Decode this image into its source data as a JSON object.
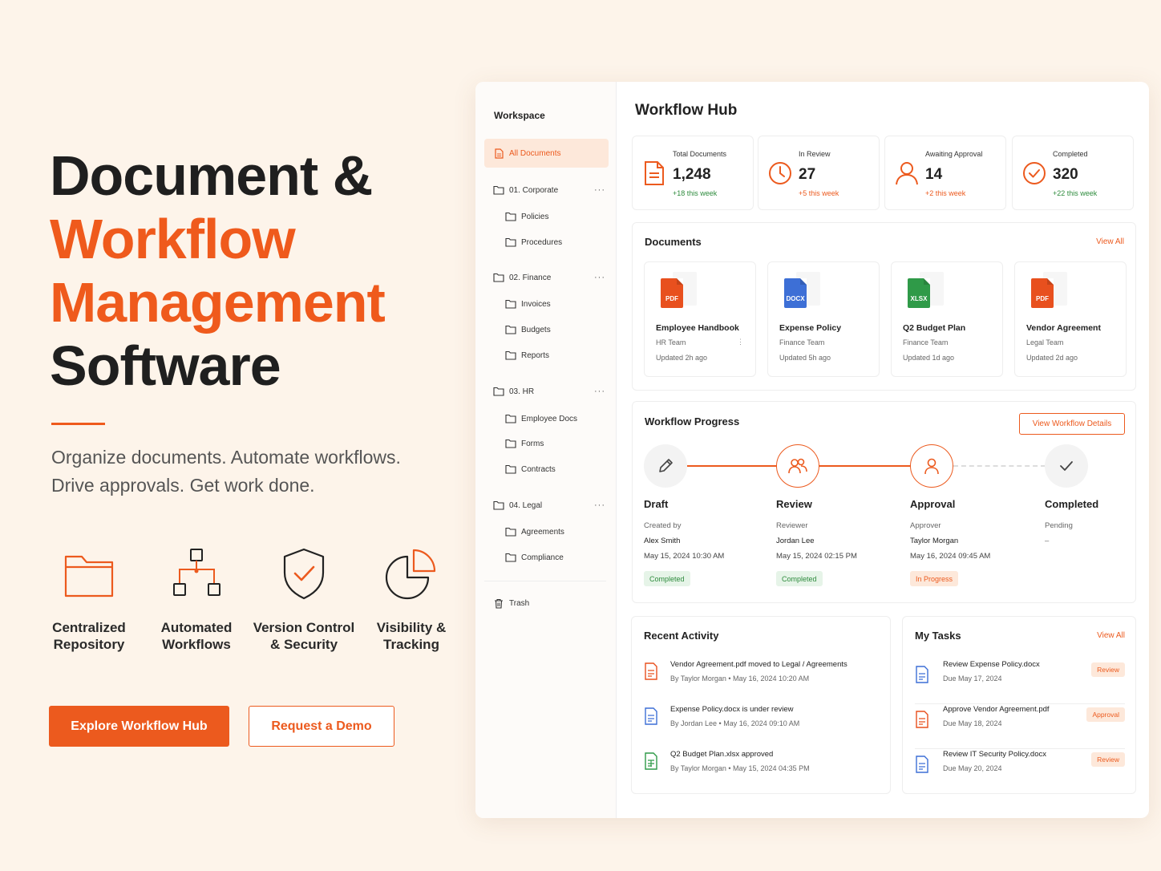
{
  "hero": {
    "line1": "Document &",
    "line2": "Workflow",
    "line3": "Management",
    "line4": "Software",
    "tagline": "Organize documents. Automate workflows. Drive approvals. Get work done."
  },
  "features": [
    {
      "label": "Centralized Repository",
      "icon": "folder-icon"
    },
    {
      "label": "Automated Workflows",
      "icon": "workflow-tree-icon"
    },
    {
      "label": "Version Control & Security",
      "icon": "shield-check-icon"
    },
    {
      "label": "Visibility & Tracking",
      "icon": "pie-chart-icon"
    }
  ],
  "cta": {
    "primary": "Explore Workflow Hub",
    "secondary": "Request a Demo"
  },
  "sidebar": {
    "title": "Workspace",
    "items": [
      {
        "label": "All Documents"
      },
      {
        "label": "01. Corporate"
      },
      {
        "label": "Policies"
      },
      {
        "label": "Procedures"
      },
      {
        "label": "02. Finance"
      },
      {
        "label": "Invoices"
      },
      {
        "label": "Budgets"
      },
      {
        "label": "Reports"
      },
      {
        "label": "03. HR"
      },
      {
        "label": "Employee Docs"
      },
      {
        "label": "Forms"
      },
      {
        "label": "Contracts"
      },
      {
        "label": "04. Legal"
      },
      {
        "label": "Agreements"
      },
      {
        "label": "Compliance"
      },
      {
        "label": "Trash"
      }
    ],
    "more": "···"
  },
  "main": {
    "title": "Workflow Hub",
    "stats": [
      {
        "label": "Total Documents",
        "value": "1,248",
        "delta": "+18 this week",
        "delta_color": "#2e8b3d"
      },
      {
        "label": "In Review",
        "value": "27",
        "delta": "+5 this week",
        "delta_color": "#ec5a1e"
      },
      {
        "label": "Awaiting Approval",
        "value": "14",
        "delta": "+2 this week",
        "delta_color": "#ec5a1e"
      },
      {
        "label": "Completed",
        "value": "320",
        "delta": "+22 this week",
        "delta_color": "#2e8b3d"
      }
    ],
    "documents": {
      "title": "Documents",
      "view_all": "View All",
      "items": [
        {
          "ext": "PDF",
          "name": "Employee Handbook",
          "team": "HR Team",
          "updated": "Updated 2h ago",
          "color": "#e8501e"
        },
        {
          "ext": "DOCX",
          "name": "Expense Policy",
          "team": "Finance Team",
          "updated": "Updated 5h ago",
          "color": "#3d6fd6"
        },
        {
          "ext": "XLSX",
          "name": "Q2 Budget Plan",
          "team": "Finance Team",
          "updated": "Updated 1d ago",
          "color": "#2f9a48"
        },
        {
          "ext": "PDF",
          "name": "Vendor Agreement",
          "team": "Legal Team",
          "updated": "Updated 2d ago",
          "color": "#e8501e"
        }
      ],
      "kebab": "⋮"
    },
    "workflow": {
      "title": "Workflow Progress",
      "details": "View Workflow Details",
      "steps": [
        {
          "name": "Draft",
          "role": "Created by",
          "person": "Alex Smith",
          "date": "May 15, 2024 10:30 AM",
          "status": "Completed"
        },
        {
          "name": "Review",
          "role": "Reviewer",
          "person": "Jordan Lee",
          "date": "May 15, 2024 02:15 PM",
          "status": "Completed"
        },
        {
          "name": "Approval",
          "role": "Approver",
          "person": "Taylor Morgan",
          "date": "May 16, 2024 09:45 AM",
          "status": "In Progress"
        },
        {
          "name": "Completed",
          "role": "Pending",
          "person": "–",
          "date": "",
          "status": ""
        }
      ]
    },
    "activity": {
      "title": "Recent Activity",
      "items": [
        {
          "title": "Vendor Agreement.pdf moved to Legal / Agreements",
          "meta": "By Taylor Morgan • May 16, 2024 10:20 AM",
          "color": "#e8501e"
        },
        {
          "title": "Expense Policy.docx is under review",
          "meta": "By Jordan Lee • May 16, 2024 09:10 AM",
          "color": "#3d6fd6"
        },
        {
          "title": "Q2 Budget Plan.xlsx approved",
          "meta": "By Taylor Morgan • May 15, 2024 04:35 PM",
          "color": "#2f9a48"
        }
      ]
    },
    "tasks": {
      "title": "My Tasks",
      "view_all": "View All",
      "items": [
        {
          "title": "Review Expense Policy.docx",
          "due": "Due May 17, 2024",
          "badge": "Review",
          "color": "#3d6fd6"
        },
        {
          "title": "Approve Vendor Agreement.pdf",
          "due": "Due May 18, 2024",
          "badge": "Approval",
          "color": "#e8501e"
        },
        {
          "title": "Review IT Security Policy.docx",
          "due": "Due May 20, 2024",
          "badge": "Review",
          "color": "#3d6fd6"
        }
      ]
    }
  }
}
